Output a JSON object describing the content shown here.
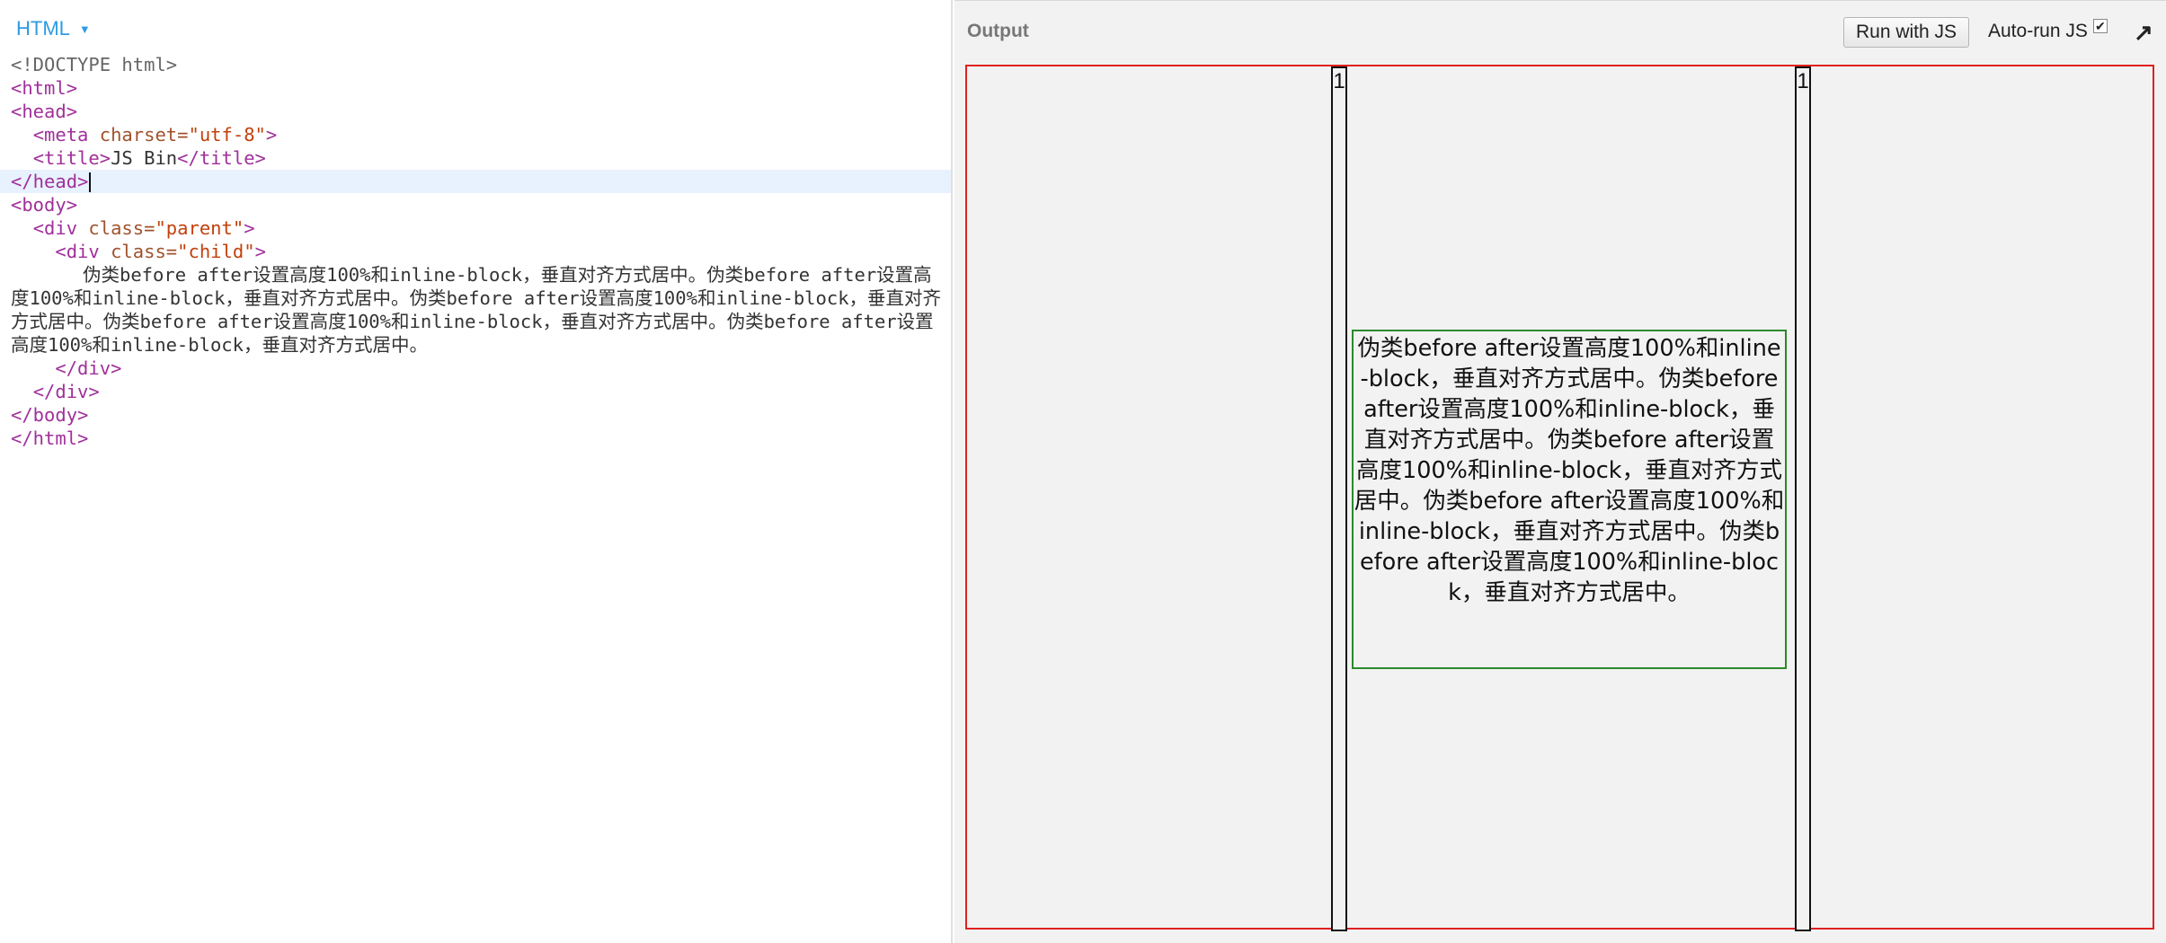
{
  "editor": {
    "language": "HTML",
    "code": {
      "doctype": "<!DOCTYPE html>",
      "html_open": "<html>",
      "head_open": "<head>",
      "meta_open": "<meta ",
      "meta_attr": "charset=",
      "meta_value": "\"utf-8\"",
      "meta_close": ">",
      "title_open": "<title>",
      "title_text": "JS Bin",
      "title_close": "</title>",
      "head_close": "</head>",
      "body_open": "<body>",
      "div_open": "<div ",
      "class_attr": "class=",
      "parent_value": "\"parent\"",
      "child_value": "\"child\"",
      "gt": ">",
      "content_text": "伪类before after设置高度100%和inline-block，垂直对齐方式居中。伪类before after设置高度100%和inline-block，垂直对齐方式居中。伪类before after设置高度100%和inline-block，垂直对齐方式居中。伪类before after设置高度100%和inline-block，垂直对齐方式居中。伪类before after设置高度100%和inline-block，垂直对齐方式居中。",
      "div_close": "</div>",
      "body_close": "</body>",
      "html_close": "</html>"
    }
  },
  "output": {
    "label": "Output",
    "run_button": "Run with JS",
    "autorun_label": "Auto-run JS",
    "autorun_check": "✔",
    "popout_icon": "↗",
    "bar_left_text": "1",
    "bar_right_text": "1",
    "child_text": "伪类before after设置高度100%和inline-block，垂直对齐方式居中。伪类before after设置高度100%和inline-block，垂直对齐方式居中。伪类before after设置高度100%和inline-block，垂直对齐方式居中。伪类before after设置高度100%和inline-block，垂直对齐方式居中。伪类before after设置高度100%和inline-block，垂直对齐方式居中。"
  },
  "colors": {
    "accent": "#2d9ce3",
    "frame_border": "#e02020",
    "child_border": "#2b8a2b"
  }
}
